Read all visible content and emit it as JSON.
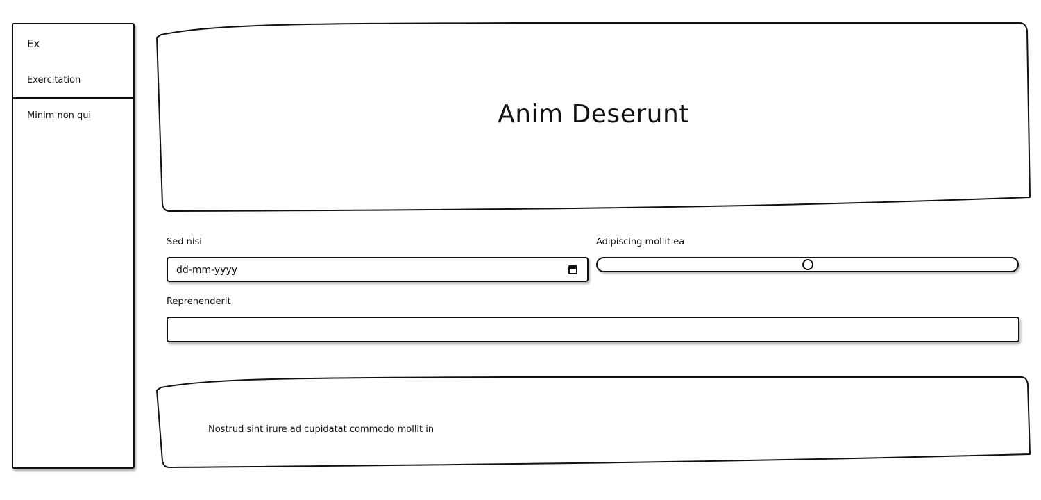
{
  "sidebar": {
    "brand": "Ex",
    "items": [
      {
        "label": "Exercitation"
      },
      {
        "label": "Minim non qui"
      }
    ]
  },
  "hero": {
    "title": "Anim Deserunt"
  },
  "form": {
    "date_field": {
      "label": "Sed nisi",
      "placeholder": "dd-mm-yyyy"
    },
    "range_field": {
      "label": "Adipiscing mollit ea",
      "value_percent": 50
    },
    "text_field": {
      "label": "Reprehenderit",
      "value": ""
    }
  },
  "footer": {
    "text": "Nostrud sint irure ad cupidatat commodo mollit in"
  },
  "icons": {
    "calendar": "calendar-icon"
  }
}
